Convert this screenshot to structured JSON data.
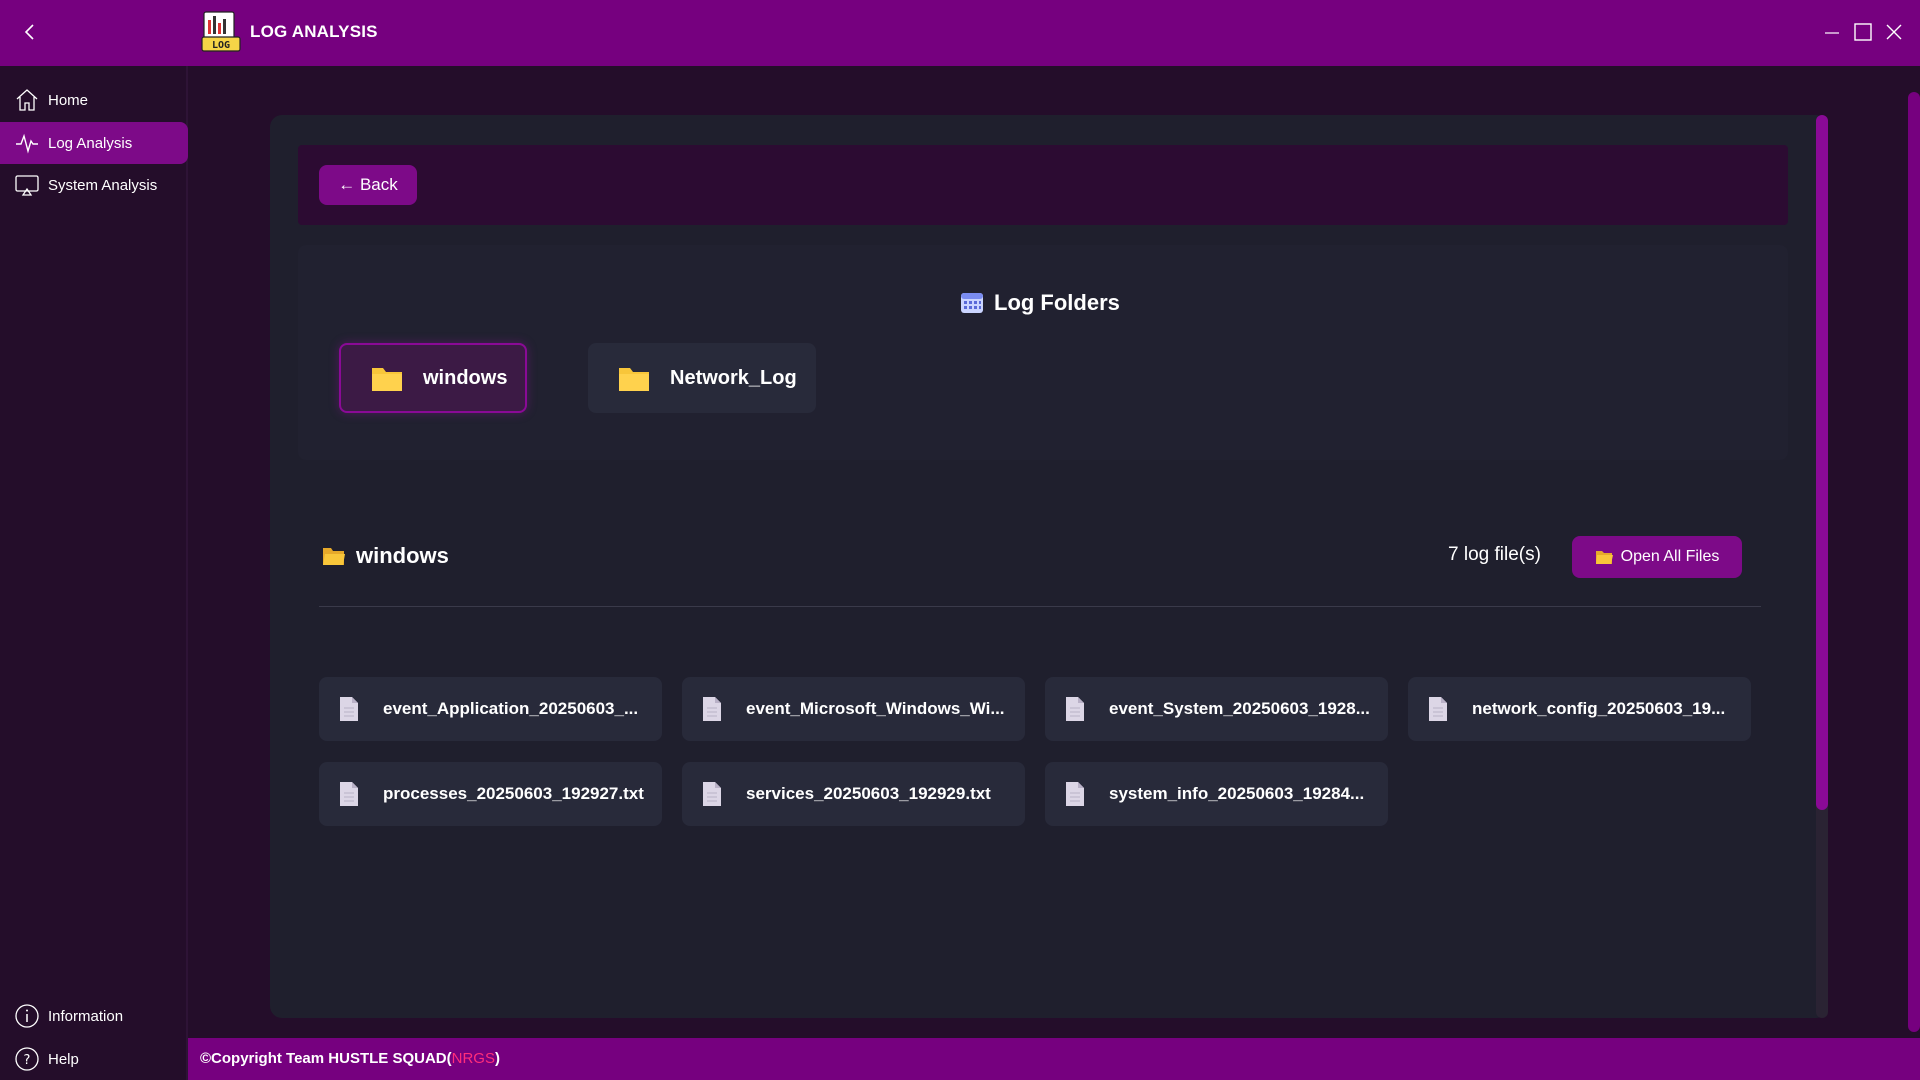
{
  "app": {
    "title": "LOG ANALYSIS",
    "logo_text": "LOG"
  },
  "sidebar": {
    "items": [
      {
        "label": "Home",
        "icon": "home-icon"
      },
      {
        "label": "Log Analysis",
        "icon": "pulse-icon",
        "active": true
      },
      {
        "label": "System Analysis",
        "icon": "monitor-icon"
      }
    ],
    "bottom_items": [
      {
        "label": "Information",
        "icon": "info-icon"
      },
      {
        "label": "Help",
        "icon": "help-icon"
      }
    ]
  },
  "toolbar": {
    "back_label": "← Back"
  },
  "folders": {
    "title": "Log Folders",
    "items": [
      {
        "name": "windows",
        "selected": true
      },
      {
        "name": "Network_Log",
        "selected": false
      }
    ]
  },
  "selected_folder": {
    "name": "windows",
    "count_text": "7 log file(s)",
    "open_all_label": "Open All Files",
    "files": [
      "event_Application_20250603_...",
      "event_Microsoft_Windows_Wi...",
      "event_System_20250603_1928...",
      "network_config_20250603_19...",
      "processes_20250603_192927.txt",
      "services_20250603_192929.txt",
      "system_info_20250603_19284..."
    ]
  },
  "footer": {
    "copyright": "©Copyright Team HUSTLE SQUAD(",
    "accent": "NRGS",
    "close": ")"
  },
  "colors": {
    "titlebar": "#76007f",
    "accent": "#7d0a88",
    "background": "#240d2a",
    "card": "#1f1f2d",
    "tile": "#282a3a",
    "folder_yellow": "#f8c63a",
    "footer_accent": "#ff2d7a"
  }
}
